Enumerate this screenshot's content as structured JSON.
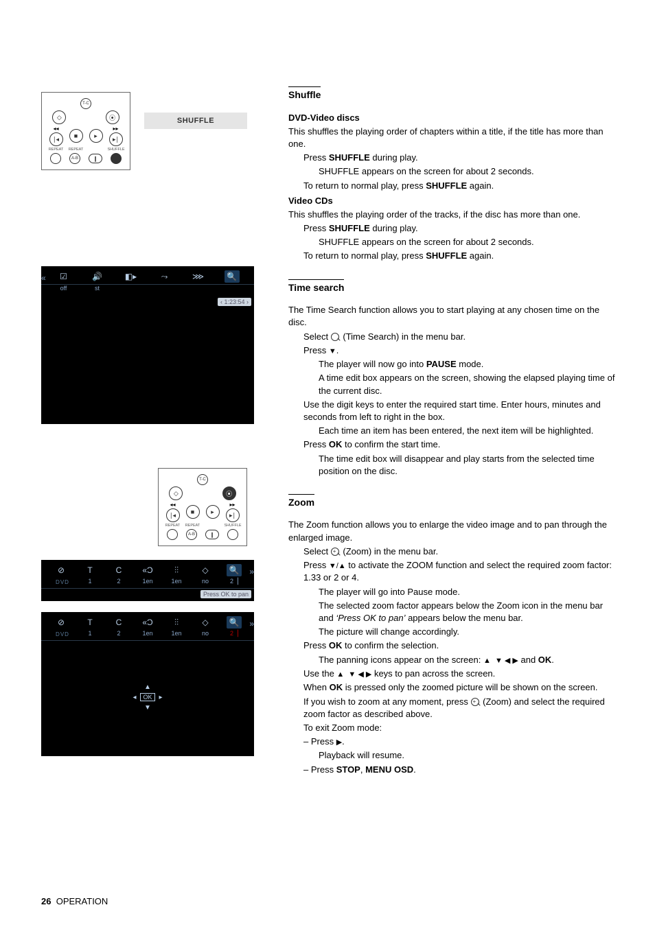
{
  "shuffle": {
    "title": "Shuffle",
    "btn_label": "SHUFFLE",
    "dvd_head": "DVD-Video discs",
    "dvd_intro": "This shuffles the playing order of chapters within a title, if the title has more than one.",
    "press_shuffle": "Press ",
    "shuffle_bold": "SHUFFLE",
    "during_play": " during play.",
    "shuffle_appears": "SHUFFLE appears on the screen for about 2 seconds.",
    "return_normal_a": "To return to normal play, press ",
    "return_normal_b": " again.",
    "vcd_head": "Video CDs",
    "vcd_intro": "This shuffles the playing order of the tracks, if the disc has more than one."
  },
  "timesearch": {
    "title": "Time search",
    "intro": "The Time Search function allows you to start playing at any chosen time on the disc.",
    "select_a": "Select ",
    "select_b": " (Time Search) in the menu bar.",
    "press_down": "Press ",
    "pause_a": "The player will now go into ",
    "pause_bold": "PAUSE",
    "pause_b": " mode.",
    "editbox": "A time edit box appears on the screen, showing the elapsed playing time of the current disc.",
    "digits": "Use the digit keys to enter the required start time. Enter hours, minutes and seconds from left to right in the box.",
    "highlight": "Each time an item has been entered, the next item will be highlighted.",
    "ok_a": "Press ",
    "ok_bold": "OK",
    "ok_b": " to confirm the start time.",
    "disappear": "The time edit box will disappear and play starts from the selected time position on the disc.",
    "time_value": "‹ 1:23:54 ›",
    "menu_labels": {
      "off": "off",
      "st": "st"
    }
  },
  "zoom": {
    "title": "Zoom",
    "intro": "The Zoom function allows you to enlarge the video image and to pan through the enlarged image.",
    "select_a": "Select ",
    "select_b": " (Zoom) in the menu bar.",
    "press_zf_a": "Press ",
    "press_zf_b": " to activate the ZOOM function and select the required zoom factor: 1.33 or 2 or 4.",
    "into_pause": "The player will go into Pause mode.",
    "factor_appears_a": "The selected zoom factor appears below the Zoom icon in the menu bar and ",
    "factor_appears_it": "‘Press OK to pan’",
    "factor_appears_b": " appears below the menu bar.",
    "picture_change": "The picture will change accordingly.",
    "ok_confirm_a": "Press ",
    "ok_confirm_b": " to confirm the selection.",
    "pan_icons_a": "The panning icons appear on the screen: ",
    "pan_icons_b": " and ",
    "pan_use_a": "Use the ",
    "pan_use_b": " keys to pan across the screen.",
    "ok_pressed_a": "When ",
    "ok_pressed_b": " is pressed only the zoomed picture will be shown on the screen.",
    "wish_a": "If you wish to zoom at any moment, press ",
    "wish_b": " (Zoom) and select the required zoom factor as described above.",
    "exit": "To exit Zoom mode:",
    "press_play": "– Press ",
    "resume": "Playback will resume.",
    "press_stop_a": "– Press ",
    "stop_bold": "STOP",
    "comma": ", ",
    "menu_osd_bold": "MENU OSD",
    "period": ".",
    "ok_bold": "OK",
    "press_ok_pan": "Press OK to pan",
    "row": {
      "v1": "1",
      "v2": "2",
      "v3": "1en",
      "v4": "1en",
      "v5": "no",
      "v6": "2▕"
    },
    "ok_label": "OK",
    "dvd_label": "DVD"
  },
  "remote": {
    "tc": "T-C",
    "repeat": "REPEAT",
    "shuffle": "SHUFFLE",
    "ab": "A-B"
  },
  "footer": {
    "page": "26",
    "section": "OPERATION"
  }
}
